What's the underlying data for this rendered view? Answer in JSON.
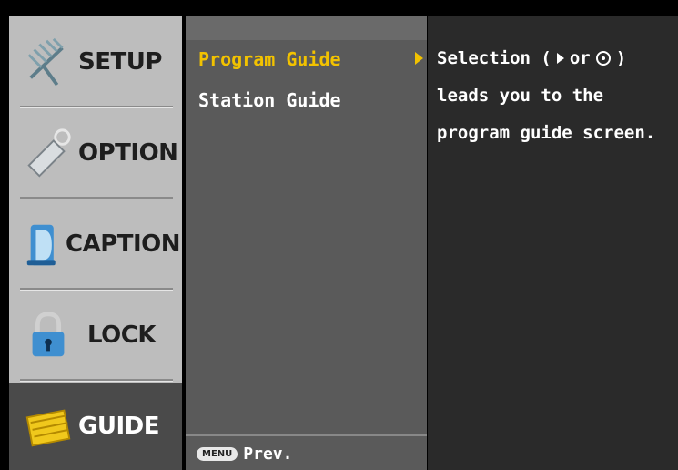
{
  "left_menu": {
    "items": [
      {
        "label": "SETUP",
        "icon": "antenna-icon"
      },
      {
        "label": "OPTION",
        "icon": "tag-icon"
      },
      {
        "label": "CAPTION",
        "icon": "caption-d-icon"
      },
      {
        "label": "LOCK",
        "icon": "padlock-icon"
      },
      {
        "label": "GUIDE",
        "icon": "guide-book-icon"
      }
    ],
    "selected_index": 4
  },
  "submenu": {
    "items": [
      "Program Guide",
      "Station Guide"
    ],
    "selected_index": 0,
    "footer": {
      "button": "MENU",
      "label": "Prev."
    }
  },
  "description": {
    "line1_prefix": "Selection (",
    "line1_mid": " or ",
    "line1_suffix": ")",
    "line2": "leads you to the",
    "line3": "program guide screen."
  },
  "colors": {
    "highlight": "#f2c200",
    "left_bg": "#bdbdbd",
    "mid_bg": "#5a5a5a",
    "right_bg": "#2a2a2a"
  }
}
